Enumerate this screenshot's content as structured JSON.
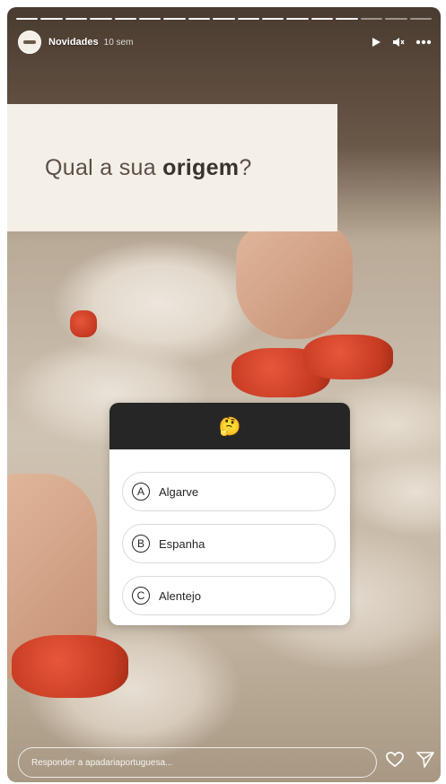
{
  "header": {
    "account_name": "Novidades",
    "time": "10 sem",
    "play_icon": "play-icon",
    "mute_icon": "mute-icon",
    "more_icon": "more-icon",
    "progress_segments": 17,
    "active_segments": 14
  },
  "question": {
    "prefix": "Qual a sua ",
    "bold": "origem",
    "suffix": "?"
  },
  "quiz": {
    "emoji": "🤔",
    "options": [
      {
        "letter": "A",
        "text": "Algarve"
      },
      {
        "letter": "B",
        "text": "Espanha"
      },
      {
        "letter": "C",
        "text": "Alentejo"
      }
    ]
  },
  "reply": {
    "placeholder": "Responder a apadariaportuguesa..."
  },
  "colors": {
    "quiz_header": "#262626",
    "question_bg": "#f4efe7"
  }
}
